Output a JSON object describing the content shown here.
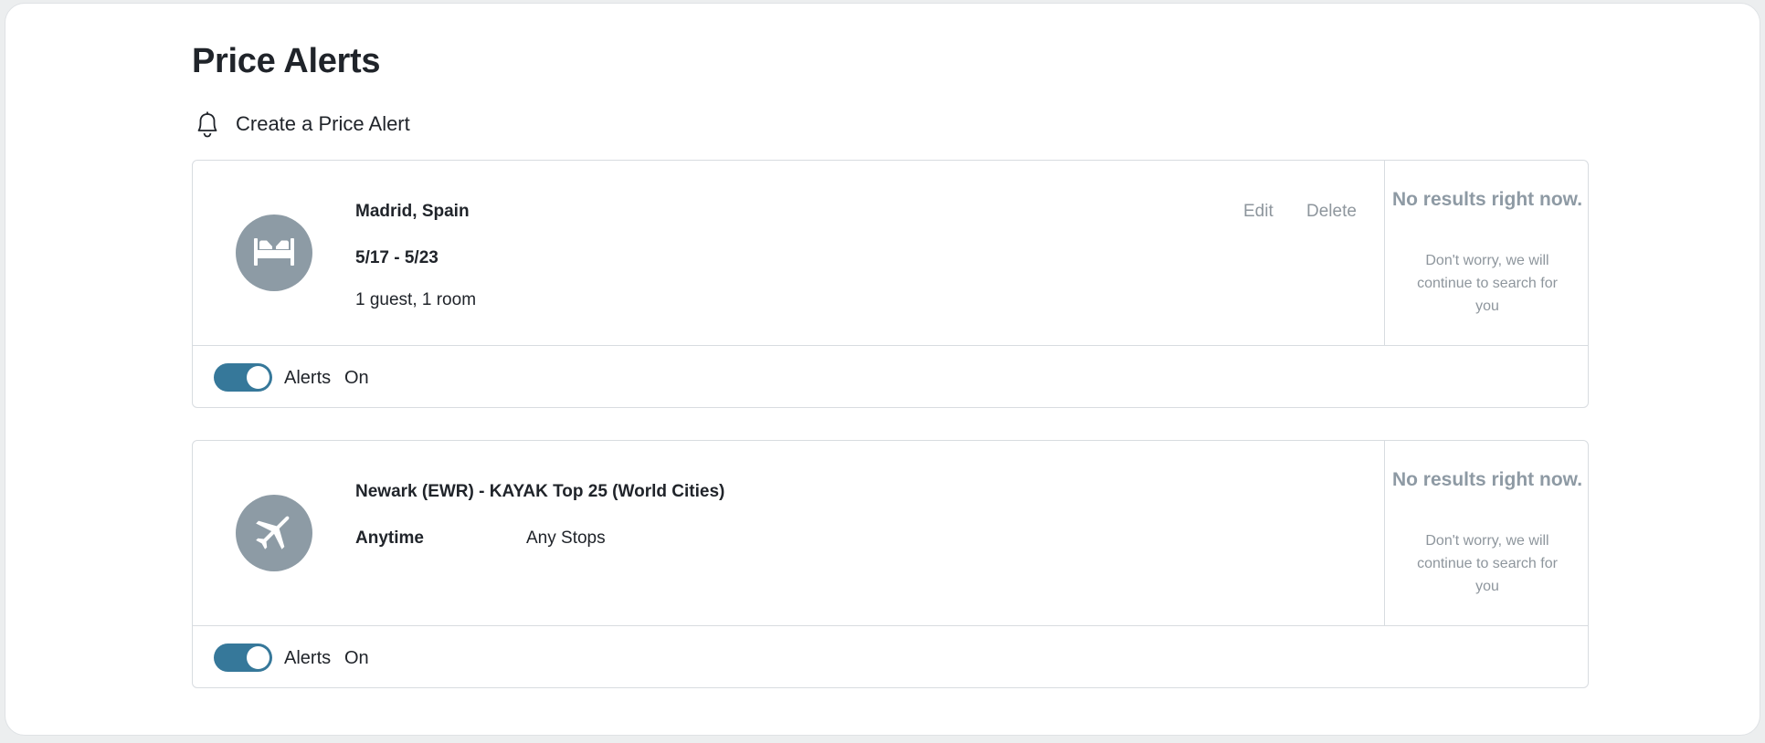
{
  "page": {
    "title": "Price Alerts",
    "create_label": "Create a Price Alert"
  },
  "alerts": [
    {
      "type_icon": "bed-icon",
      "title": "Madrid, Spain",
      "dates": "5/17 - 5/23",
      "details": "1 guest, 1 room",
      "edit_label": "Edit",
      "delete_label": "Delete",
      "results_title": "No results right now.",
      "results_note": "Don't worry, we will continue to search for you",
      "toggle_label": "Alerts",
      "toggle_state": "On"
    },
    {
      "type_icon": "airplane-icon",
      "title": "Newark (EWR) - KAYAK Top 25 (World Cities)",
      "dates": "Anytime",
      "stops": "Any Stops",
      "results_title": "No results right now.",
      "results_note": "Don't worry, we will continue to search for you",
      "toggle_label": "Alerts",
      "toggle_state": "On"
    }
  ],
  "colors": {
    "toggle_on": "#36789a",
    "icon_circle": "#8d9ba5",
    "muted_text": "#8e969d"
  }
}
